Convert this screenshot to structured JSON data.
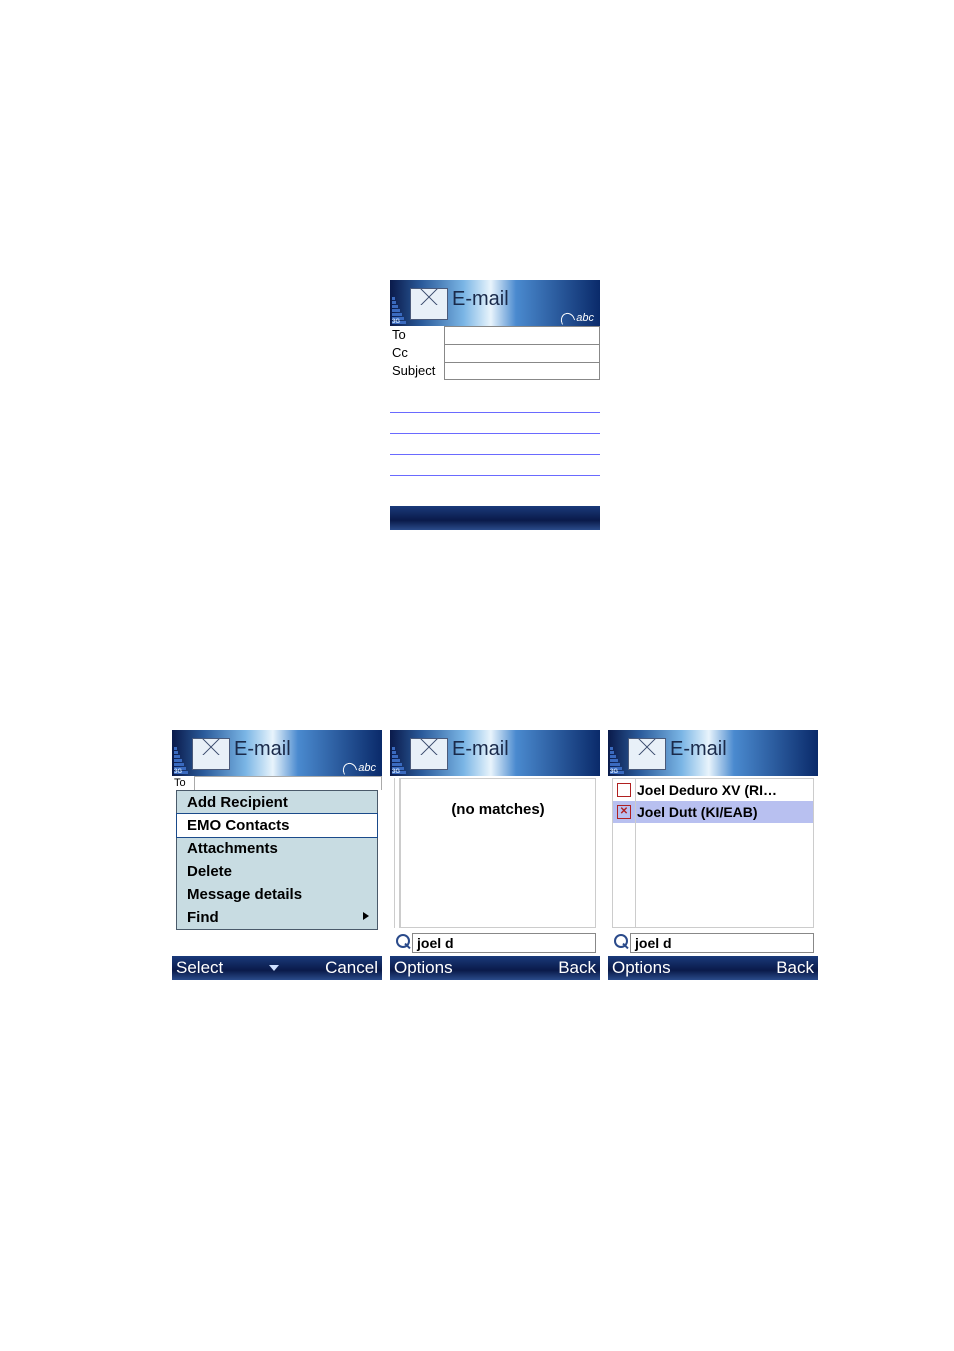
{
  "common": {
    "app_title": "E-mail",
    "input_mode": "abc",
    "net": "3G"
  },
  "screen1": {
    "fields": {
      "to": "To",
      "cc": "Cc",
      "subject": "Subject"
    },
    "to_value": "",
    "cc_value": "",
    "subject_value": ""
  },
  "screen2": {
    "to_label": "To",
    "menu": {
      "items": [
        {
          "label": "Add Recipient",
          "selected": false,
          "submenu": false
        },
        {
          "label": "EMO Contacts",
          "selected": true,
          "submenu": false
        },
        {
          "label": "Attachments",
          "selected": false,
          "submenu": false
        },
        {
          "label": "Delete",
          "selected": false,
          "submenu": false
        },
        {
          "label": "Message details",
          "selected": false,
          "submenu": false
        },
        {
          "label": "Find",
          "selected": false,
          "submenu": true
        }
      ]
    },
    "softkeys": {
      "left": "Select",
      "right": "Cancel"
    }
  },
  "screen3": {
    "no_matches": "(no matches)",
    "search_value": "joel d",
    "softkeys": {
      "left": "Options",
      "right": "Back"
    }
  },
  "screen4": {
    "results": [
      {
        "name": "Joel Deduro XV (RI…",
        "checked": false,
        "selected": false
      },
      {
        "name": "Joel Dutt (KI/EAB)",
        "checked": true,
        "selected": true
      }
    ],
    "search_value": "joel d",
    "softkeys": {
      "left": "Options",
      "right": "Back"
    }
  }
}
